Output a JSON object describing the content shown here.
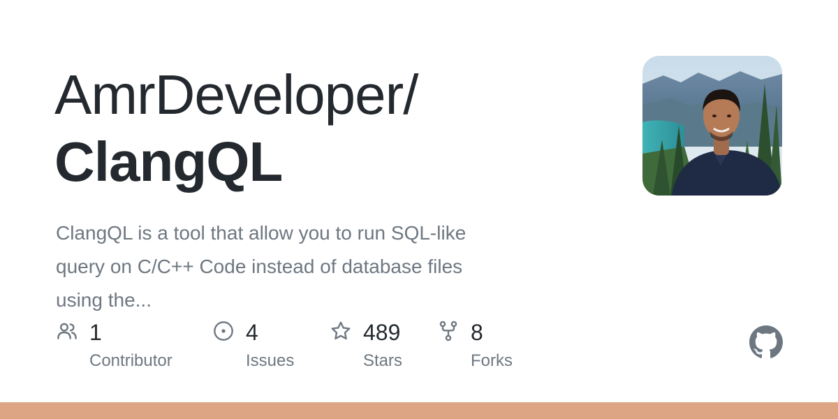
{
  "title": {
    "owner": "AmrDeveloper/",
    "repo": "ClangQL"
  },
  "description": {
    "line1": "ClangQL is a tool that allow you to run SQL-like",
    "line2": "query on C/C++ Code instead of database files",
    "line3": "using the..."
  },
  "avatar": {
    "icon": "user-avatar-photo"
  },
  "stats": {
    "contributors": {
      "value": "1",
      "label": "Contributor",
      "icon": "people-icon"
    },
    "issues": {
      "value": "4",
      "label": "Issues",
      "icon": "issue-opened-icon"
    },
    "stars": {
      "value": "489",
      "label": "Stars",
      "icon": "star-icon"
    },
    "forks": {
      "value": "8",
      "label": "Forks",
      "icon": "repo-forked-icon"
    }
  },
  "github_logo": {
    "icon": "github-mark-icon"
  },
  "colors": {
    "text_primary": "#24292f",
    "text_secondary": "#6e7781",
    "language_bar": "#dea584",
    "github_logo": "#6e7781"
  }
}
